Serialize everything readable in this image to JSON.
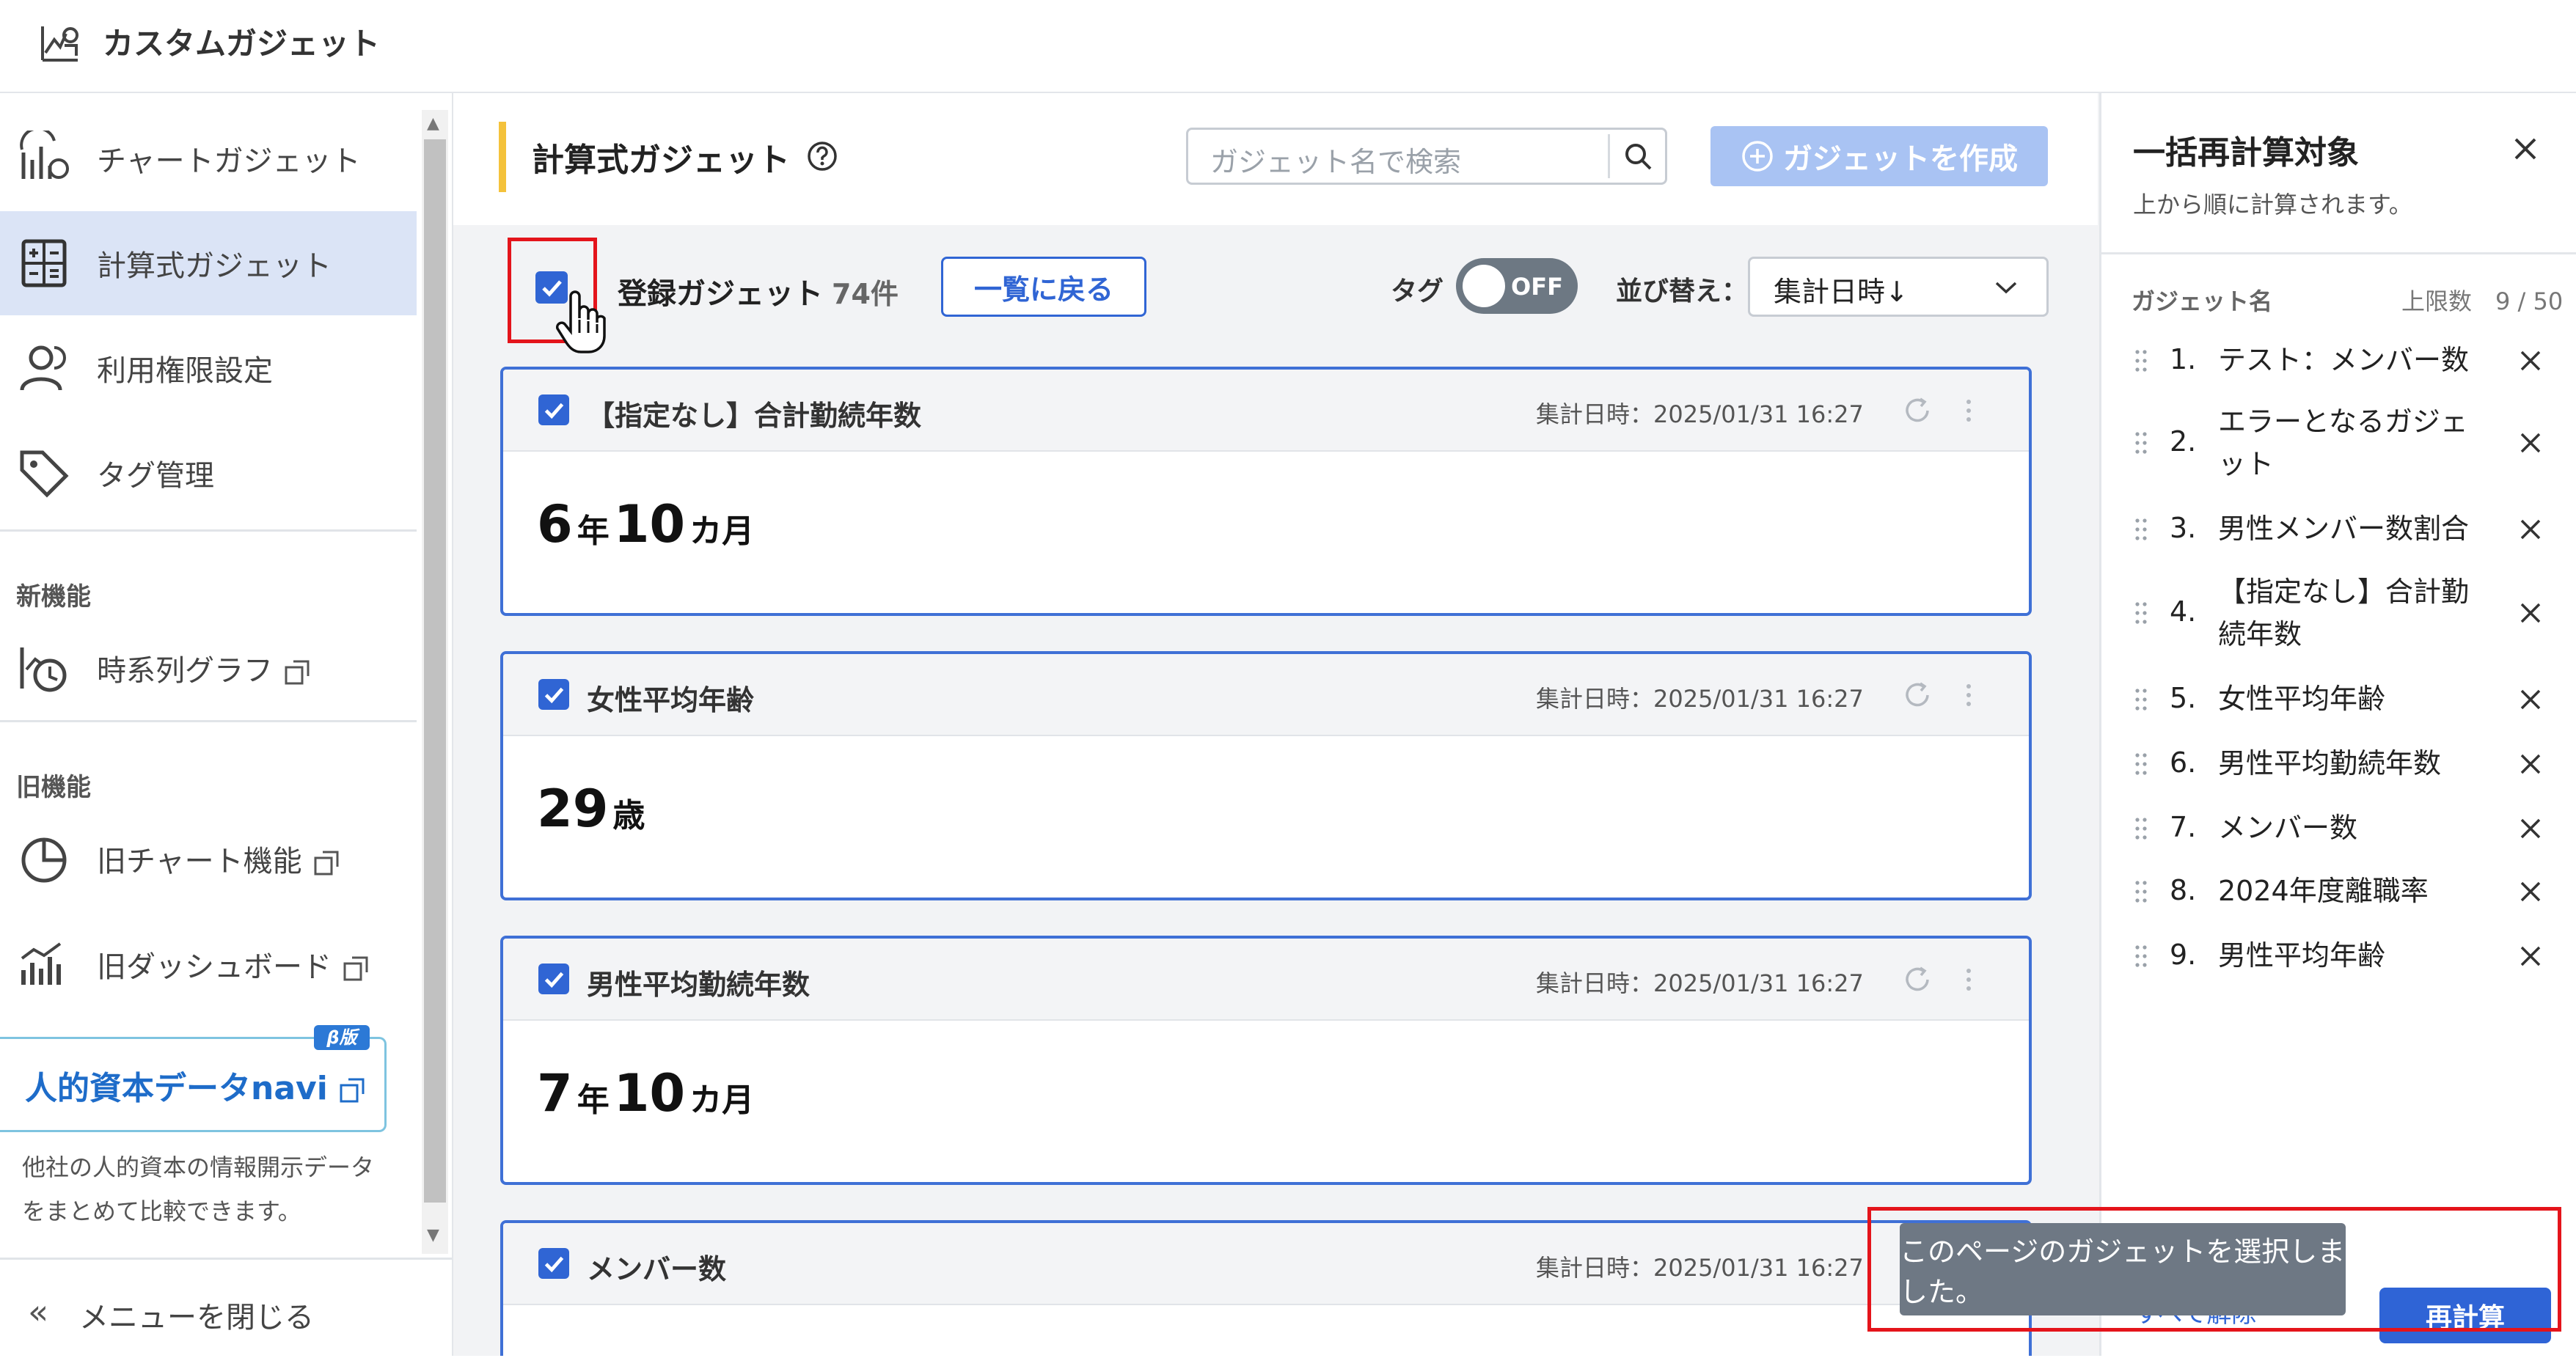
{
  "app": {
    "title": "カスタムガジェット"
  },
  "sidebar": {
    "items": [
      {
        "label": "チャートガジェット",
        "icon": "chart-gadget-icon"
      },
      {
        "label": "計算式ガジェット",
        "icon": "calculator-icon",
        "active": true
      },
      {
        "label": "利用権限設定",
        "icon": "user-icon"
      },
      {
        "label": "タグ管理",
        "icon": "tag-icon"
      }
    ],
    "new_section": "新機能",
    "new_items": [
      {
        "label": "時系列グラフ",
        "icon": "time-series-icon"
      }
    ],
    "old_section": "旧機能",
    "old_items": [
      {
        "label": "旧チャート機能",
        "icon": "pie-chart-icon"
      },
      {
        "label": "旧ダッシュボード",
        "icon": "dashboard-icon"
      }
    ],
    "navi": {
      "beta": "β版",
      "logo": "人的資本データnavi",
      "description": "他社の人的資本の情報開示データをまとめて比較できます。"
    },
    "collapse_label": "メニューを閉じる"
  },
  "main": {
    "title": "計算式ガジェット",
    "search_placeholder": "ガジェット名で検索",
    "create_button": "ガジェットを作成",
    "registered_label": "登録ガジェット",
    "registered_count": "74件",
    "back_button": "一覧に戻る",
    "tag_label": "タグ",
    "tag_toggle": "OFF",
    "sort_label": "並び替え：",
    "sort_value": "集計日時↓",
    "cards": [
      {
        "title": "【指定なし】合計勤続年数",
        "date": "集計日時：2025/01/31 16:27",
        "value_parts": [
          "6",
          "年",
          "10",
          "カ月"
        ]
      },
      {
        "title": "女性平均年齢",
        "date": "集計日時：2025/01/31 16:27",
        "value_parts": [
          "29",
          "歳"
        ]
      },
      {
        "title": "男性平均勤続年数",
        "date": "集計日時：2025/01/31 16:27",
        "value_parts": [
          "7",
          "年",
          "10",
          "カ月"
        ]
      },
      {
        "title": "メンバー数",
        "date": "集計日時：2025/01/31 16:27",
        "value_parts": []
      }
    ]
  },
  "right_panel": {
    "title": "一括再計算対象",
    "subtitle": "上から順に計算されます。",
    "col_name": "ガジェット名",
    "limit": "上限数　9 / 50",
    "items": [
      {
        "num": "1.",
        "label": "テスト：メンバー数"
      },
      {
        "num": "2.",
        "label": "エラーとなるガジェット"
      },
      {
        "num": "3.",
        "label": "男性メンバー数割合"
      },
      {
        "num": "4.",
        "label": "【指定なし】合計勤続年数"
      },
      {
        "num": "5.",
        "label": "女性平均年齢"
      },
      {
        "num": "6.",
        "label": "男性平均勤続年数"
      },
      {
        "num": "7.",
        "label": "メンバー数"
      },
      {
        "num": "8.",
        "label": "2024年度離職率"
      },
      {
        "num": "9.",
        "label": "男性平均年齢"
      }
    ],
    "clear_all": "すべて解除",
    "recalc_button": "再計算"
  },
  "toast": {
    "message": "このページのガジェットを選択しました。"
  },
  "colors": {
    "accent": "#3065d4",
    "highlight": "#e4141b",
    "title_bar": "#f4c23b",
    "active_nav": "#dbe4f6",
    "toast": "#6e7884"
  }
}
